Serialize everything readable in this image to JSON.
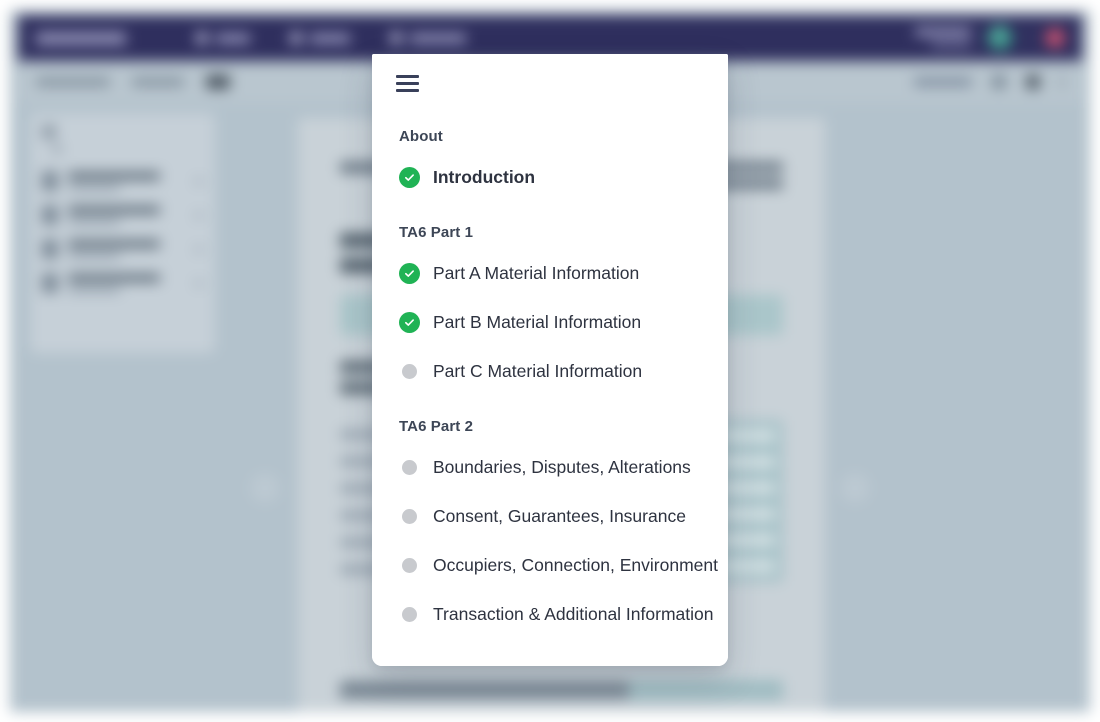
{
  "background": {
    "topnav": {
      "logo": "logo",
      "items": [
        {
          "label": "nav-item-1",
          "icon": "grid-icon"
        },
        {
          "label": "nav-item-2",
          "icon": "document-icon"
        },
        {
          "label": "nav-item-3",
          "icon": "folder-icon"
        }
      ],
      "user": {
        "name_line": "user-name",
        "role_line": "user-role",
        "avatar": "user-avatar"
      },
      "badge": "notification-badge"
    },
    "subbar": {
      "breadcrumb": [
        "crumb-1",
        "crumb-2"
      ],
      "pill": "crumb-pill",
      "right": {
        "text": "toolbar-label",
        "icons": [
          "toolbar-icon-1",
          "toolbar-icon-2"
        ],
        "more": "more-options"
      }
    },
    "sidebar": {
      "title": "Documents",
      "items": [
        "doc-item-1",
        "doc-item-2",
        "doc-item-3",
        "doc-item-4"
      ]
    },
    "document": {
      "title": "document-title",
      "sections": [
        "section-1",
        "section-2"
      ]
    },
    "pager": {
      "prev": "previous-page",
      "next": "next-page"
    }
  },
  "modal": {
    "menu_icon": "hamburger-menu",
    "sections": [
      {
        "title": "About",
        "items": [
          {
            "label": "Introduction",
            "state": "done",
            "bold": true
          }
        ]
      },
      {
        "title": "TA6 Part 1",
        "items": [
          {
            "label": "Part A Material Information",
            "state": "done",
            "bold": false
          },
          {
            "label": "Part B Material Information",
            "state": "done",
            "bold": false
          },
          {
            "label": "Part C Material Information",
            "state": "pending",
            "bold": false
          }
        ]
      },
      {
        "title": "TA6 Part 2",
        "items": [
          {
            "label": "Boundaries, Disputes, Alterations",
            "state": "pending",
            "bold": false
          },
          {
            "label": "Consent, Guarantees, Insurance",
            "state": "pending",
            "bold": false
          },
          {
            "label": "Occupiers, Connection, Environment",
            "state": "pending",
            "bold": false
          },
          {
            "label": "Transaction & Additional Information",
            "state": "pending",
            "bold": false
          }
        ]
      }
    ]
  },
  "colors": {
    "modal_bg": "#ffffff",
    "complete_green": "#20b355",
    "pending_gray": "#c8cace",
    "section_title": "#3d4656",
    "item_text": "#2e3340",
    "topnav_navy": "#2f2f5e",
    "page_bg": "#b3c2cc"
  }
}
